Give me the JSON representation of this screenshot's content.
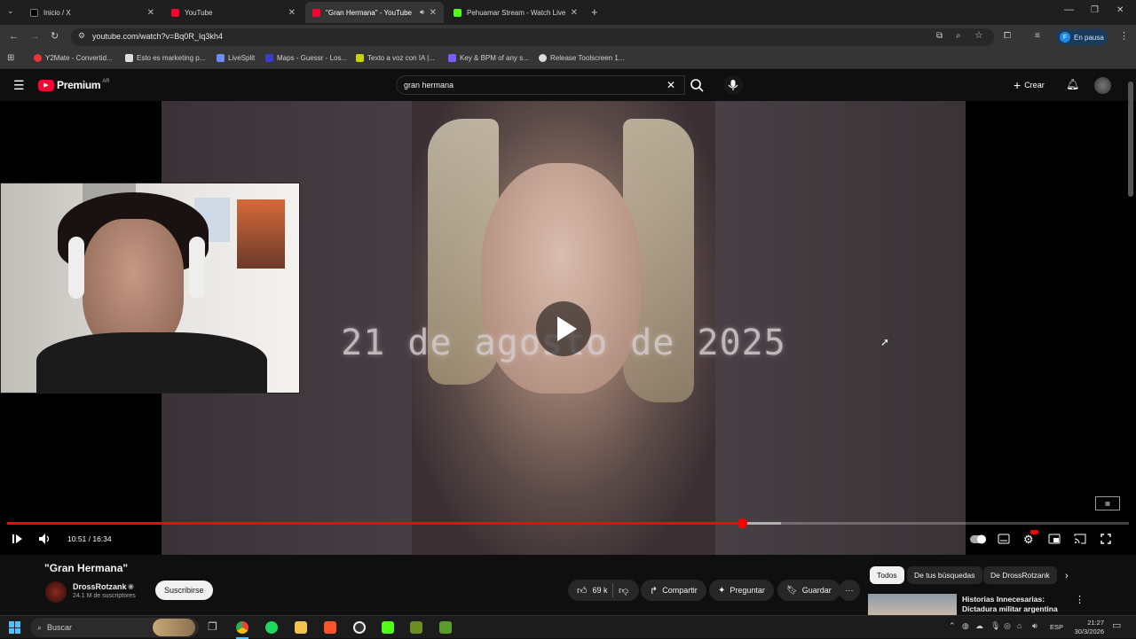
{
  "browser": {
    "tabs": [
      {
        "label": "Inicio / X",
        "fav_color": "#1f1f1f"
      },
      {
        "label": "YouTube",
        "fav_color": "#ff0033"
      },
      {
        "label": "\"Gran Hermana\" - YouTube",
        "fav_color": "#ff0033"
      },
      {
        "label": "Pehuamar Stream - Watch Live",
        "fav_color": "#53fc18"
      }
    ],
    "url": "youtube.com/watch?v=Bq0R_Iq3kh4",
    "profile_label": "En pausa",
    "profile_initial": "F",
    "bookmarks": [
      {
        "label": "Y2Mate - Convertid...",
        "color": "#e33"
      },
      {
        "label": "Esto es marketing p...",
        "color": "#ddd"
      },
      {
        "label": "LiveSplit",
        "color": "#6a8cff"
      },
      {
        "label": "Maps - Guessr - Los...",
        "color": "#3b3bd1"
      },
      {
        "label": "Texto a voz con IA |...",
        "color": "#c6d300"
      },
      {
        "label": "Key & BPM of any s...",
        "color": "#7b5cff"
      },
      {
        "label": "Release Toolscreen 1...",
        "color": "#ddd"
      }
    ]
  },
  "youtube": {
    "logo_text": "Premium",
    "logo_region": "AR",
    "search_value": "gran hermana",
    "create_label": "Crear",
    "brand_color": "#ff0033"
  },
  "player": {
    "overlay_text": "21 de agosto de 2025",
    "time_text": "10:51 / 16:34",
    "progress": 0.655,
    "buffered": 0.69
  },
  "video": {
    "title": "\"Gran Hermana\"",
    "channel": "DrossRotzank",
    "subscribers": "24.1 M de suscriptores",
    "subscribe_label": "Suscribirse",
    "likes": "69 k",
    "share_label": "Compartir",
    "ask_label": "Preguntar",
    "save_label": "Guardar"
  },
  "chips": [
    "Todos",
    "De tus búsquedas",
    "De DrossRotzank"
  ],
  "recommendation": {
    "title_line1": "Historias Innecesarias:",
    "title_line2": "Dictadura militar argentina"
  },
  "taskbar": {
    "search_label": "Buscar",
    "lang": "ESP",
    "time": "21:27",
    "date": "30/3/2026"
  }
}
